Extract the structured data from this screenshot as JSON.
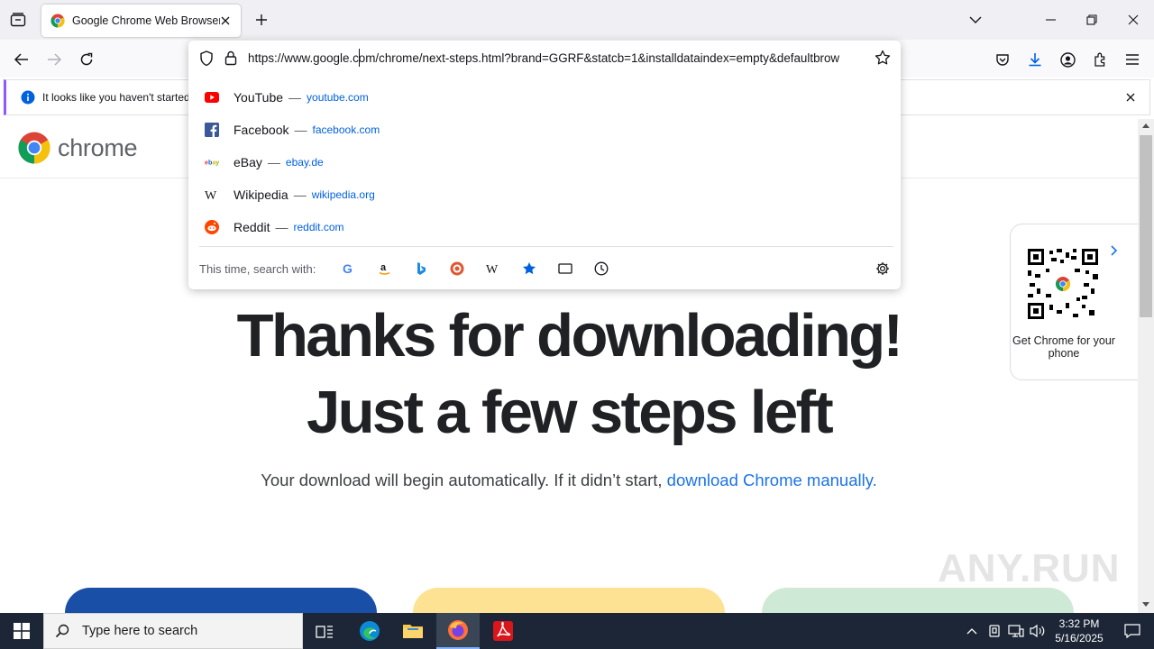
{
  "window": {
    "tab_title": "Google Chrome Web Browser: I",
    "colors": {
      "accent": "#0061e0",
      "tabstrip_bg": "#f0f0f4",
      "taskbar_bg": "#1c2636"
    }
  },
  "toolbar": {
    "url": "https://www.google.com/chrome/next-steps.html?brand=GGRF&statcb=1&installdataindex=empty&defaultbrow"
  },
  "suggestions": [
    {
      "title": "YouTube",
      "sep": "—",
      "url": "youtube.com",
      "icon": "youtube-icon"
    },
    {
      "title": "Facebook",
      "sep": "—",
      "url": "facebook.com",
      "icon": "facebook-icon"
    },
    {
      "title": "eBay",
      "sep": "—",
      "url": "ebay.de",
      "icon": "ebay-icon"
    },
    {
      "title": "Wikipedia",
      "sep": "—",
      "url": "wikipedia.org",
      "icon": "wikipedia-icon"
    },
    {
      "title": "Reddit",
      "sep": "—",
      "url": "reddit.com",
      "icon": "reddit-icon"
    }
  ],
  "search_with": {
    "label": "This time, search with:",
    "engines": [
      "google-icon",
      "amazon-icon",
      "bing-icon",
      "duckduckgo-icon",
      "wikipedia-icon",
      "bookmarks-icon",
      "tabs-icon",
      "history-icon"
    ]
  },
  "notification": {
    "text": "It looks like you haven't started"
  },
  "page": {
    "brand": "chrome",
    "headline_line1": "Thanks for downloading!",
    "headline_line2": "Just a few steps left",
    "subline_text": "Your download will begin automatically. If it didn’t start, ",
    "subline_link": "download Chrome manually.",
    "qr_caption": "Get Chrome for your phone",
    "watermark": "ANY.RUN"
  },
  "taskbar": {
    "search_placeholder": "Type here to search",
    "time": "3:32 PM",
    "date": "5/16/2025"
  }
}
